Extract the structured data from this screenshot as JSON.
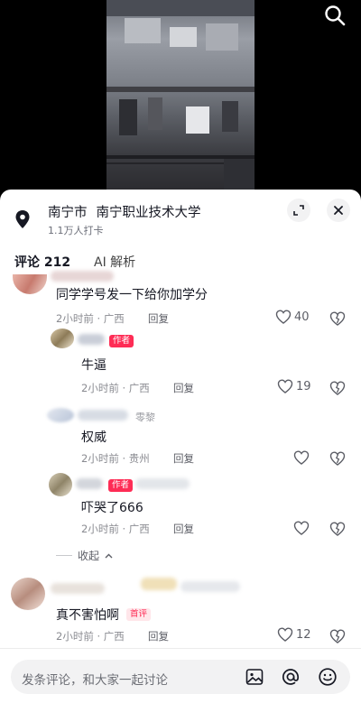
{
  "video": {},
  "location": {
    "city": "南宁市",
    "place": "南宁职业技术大学",
    "checkins": "1.1万人打卡"
  },
  "tabs": [
    {
      "label": "评论 212"
    },
    {
      "label": "AI 解析"
    }
  ],
  "comments": [
    {
      "text": "同学学号发一下给你加学分",
      "time": "2小时前 · 广西",
      "reply": "回复",
      "likes": "40"
    },
    {
      "badge": "作者",
      "text": "牛逼",
      "time": "2小时前 · 广西",
      "reply": "回复",
      "likes": "19"
    },
    {
      "name_suffix": "零黎",
      "text": "权威",
      "time": "2小时前 · 贵州",
      "reply": "回复",
      "likes": ""
    },
    {
      "badge": "作者",
      "text": "吓哭了666",
      "time": "2小时前 · 广西",
      "reply": "回复",
      "likes": ""
    },
    {
      "badge": "首评",
      "text": "真不害怕啊",
      "time": "2小时前 · 广西",
      "reply": "回复",
      "likes": "12"
    }
  ],
  "collapse_label": "收起",
  "input": {
    "placeholder": "发条评论，和大家一起讨论"
  },
  "icons": [
    "search-icon",
    "location-pin-icon",
    "minimize-icon",
    "close-icon",
    "heart-icon",
    "dislike-icon",
    "image-icon",
    "at-icon",
    "emoji-icon",
    "chevron-up-icon"
  ],
  "colors": {
    "accent": "#fe2c55",
    "sheet": "#ffffff",
    "text": "#161823",
    "meta": "#8a8b91"
  }
}
